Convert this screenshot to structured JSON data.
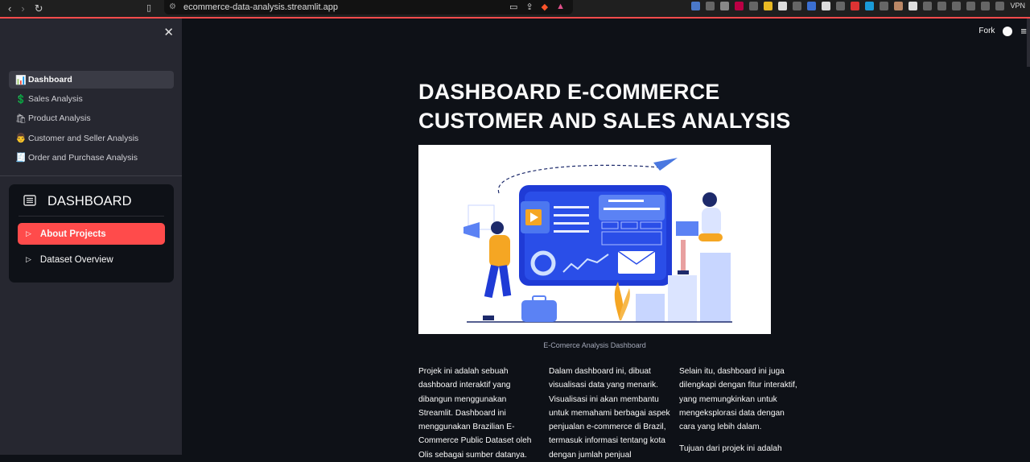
{
  "browser": {
    "url": "ecommerce-data-analysis.streamlit.app",
    "vpn_label": "VPN"
  },
  "sidebar": {
    "pages": [
      {
        "icon": "📊",
        "label": "Dashboard",
        "active": true
      },
      {
        "icon": "💲",
        "label": "Sales Analysis"
      },
      {
        "icon": "🛍",
        "label": "Product Analysis"
      },
      {
        "icon": "👨",
        "label": "Customer and Seller Analysis"
      },
      {
        "icon": "🧾",
        "label": "Order and Purchase Analysis"
      }
    ],
    "menu": {
      "title": "DASHBOARD",
      "options": [
        {
          "label": "About Projects",
          "active": true
        },
        {
          "label": "Dataset Overview"
        }
      ]
    }
  },
  "topbar": {
    "fork_label": "Fork"
  },
  "main": {
    "title_line1": "DASHBOARD E-COMMERCE",
    "title_line2": "CUSTOMER AND SALES ANALYSIS",
    "image_caption": "E-Comerce Analysis Dashboard",
    "col1_p1": "Projek ini adalah sebuah dashboard interaktif yang dibangun menggunakan Streamlit. Dashboard ini menggunakan Brazilian E-Commerce Public Dataset oleh Olis sebagai sumber datanya.",
    "col2_p1": "Dalam dashboard ini, dibuat visualisasi data yang menarik. Visualisasi ini akan membantu untuk memahami berbagai aspek penjualan e-commerce di Brazil, termasuk informasi tentang kota dengan jumlah penjual",
    "col3_p1": "Selain itu, dashboard ini juga dilengkapi dengan fitur interaktif, yang memungkinkan untuk mengeksplorasi data dengan cara yang lebih dalam.",
    "col3_p2": "Tujuan dari projek ini adalah"
  },
  "colors": {
    "accent": "#ff4b4b",
    "background": "#0e1117",
    "sidebar": "#262730"
  }
}
